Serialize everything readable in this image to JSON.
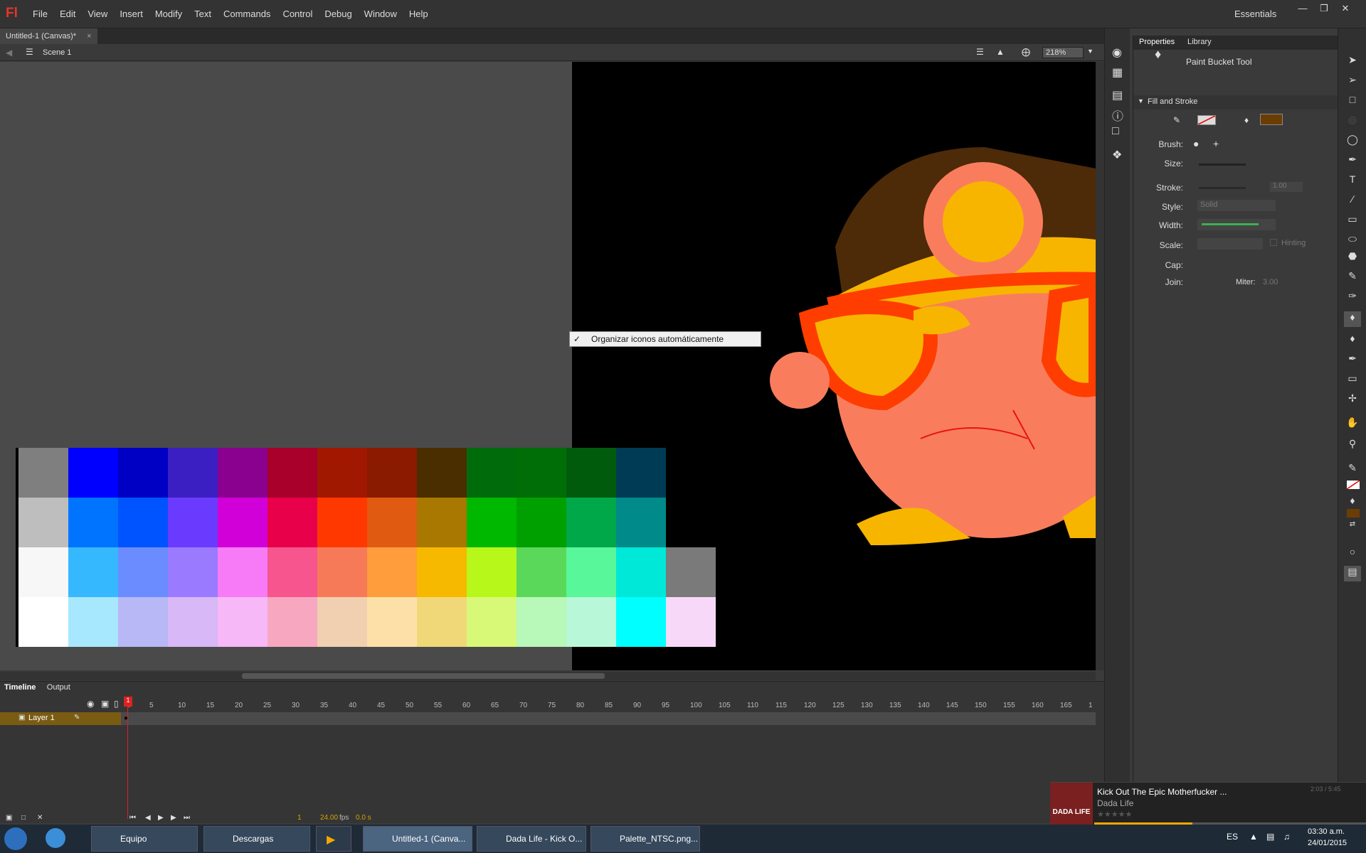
{
  "app": {
    "logo": "Fl",
    "menus": [
      "File",
      "Edit",
      "View",
      "Insert",
      "Modify",
      "Text",
      "Commands",
      "Control",
      "Debug",
      "Window",
      "Help"
    ],
    "workspace": "Essentials"
  },
  "document": {
    "tab": "Untitled-1 (Canvas)*",
    "close": "×",
    "scene": "Scene 1",
    "zoom": "218%"
  },
  "context_menu": {
    "check": "✓",
    "item": "Organizar iconos automáticamente"
  },
  "timeline": {
    "tabs": [
      "Timeline",
      "Output"
    ],
    "frames": [
      "1",
      "5",
      "10",
      "15",
      "20",
      "25",
      "30",
      "35",
      "40",
      "45",
      "50",
      "55",
      "60",
      "65",
      "70",
      "75",
      "80",
      "85",
      "90",
      "95",
      "100",
      "105",
      "110",
      "115",
      "120",
      "125",
      "130",
      "135",
      "140",
      "145",
      "150",
      "155",
      "160",
      "165",
      "1"
    ],
    "layer": "Layer 1",
    "current_frame": "1",
    "fps": "24.00",
    "fps_unit": "fps",
    "time": "0.0 s"
  },
  "properties": {
    "tabs": [
      "Properties",
      "Library"
    ],
    "tool": "Paint Bucket Tool",
    "section": "Fill and Stroke",
    "brush": "Brush:",
    "size": "Size:",
    "stroke": "Stroke:",
    "stroke_val": "1.00",
    "style": "Style:",
    "style_val": "Solid",
    "width": "Width:",
    "scale": "Scale:",
    "hinting": "Hinting",
    "cap": "Cap:",
    "join": "Join:",
    "miter": "Miter:",
    "miter_val": "3.00",
    "fill_color": "#6b3d05"
  },
  "palette_rows": [
    [
      "#7f7f7f",
      "#0000ff",
      "#0000c4",
      "#3b1fc2",
      "#8a008f",
      "#a8002b",
      "#a11800",
      "#8a1a00",
      "#4a2e00",
      "#006b0a",
      "#006e06",
      "#005b0c",
      "#003b55"
    ],
    [
      "#bebebe",
      "#0074ff",
      "#0054ff",
      "#6a3bff",
      "#d100d8",
      "#e8004a",
      "#ff3800",
      "#e05a12",
      "#a87800",
      "#00b800",
      "#00a000",
      "#00a84a",
      "#008a8a"
    ],
    [
      "#f7f7f7",
      "#36b8ff",
      "#6b8cff",
      "#9a7aff",
      "#f77af7",
      "#f7558e",
      "#f77a58",
      "#ff9c3c",
      "#f7b800",
      "#b8f71a",
      "#5ad85a",
      "#58f79a",
      "#00e8d8",
      "#7a7a7a"
    ],
    [
      "#ffffff",
      "#a8e8ff",
      "#b8b8f7",
      "#d8b8f7",
      "#f7b8f7",
      "#f7a8c0",
      "#f0d0b0",
      "#fce0a8",
      "#f0d878",
      "#d8f878",
      "#b8f8b8",
      "#b8f8d8",
      "#00ffff",
      "#f8d8f8"
    ]
  ],
  "taskbar": {
    "items": [
      "Equipo",
      "Descargas",
      "",
      "Untitled-1 (Canva...",
      "Dada Life - Kick O...",
      "Palette_NTSC.png..."
    ],
    "lang": "ES",
    "time": "03:30 a.m.",
    "date": "24/01/2015"
  },
  "music": {
    "title": "Kick Out The Epic Motherfucker ...",
    "artist": "Dada Life",
    "duration": "2:03 / 5:45",
    "progress": 0.36
  }
}
